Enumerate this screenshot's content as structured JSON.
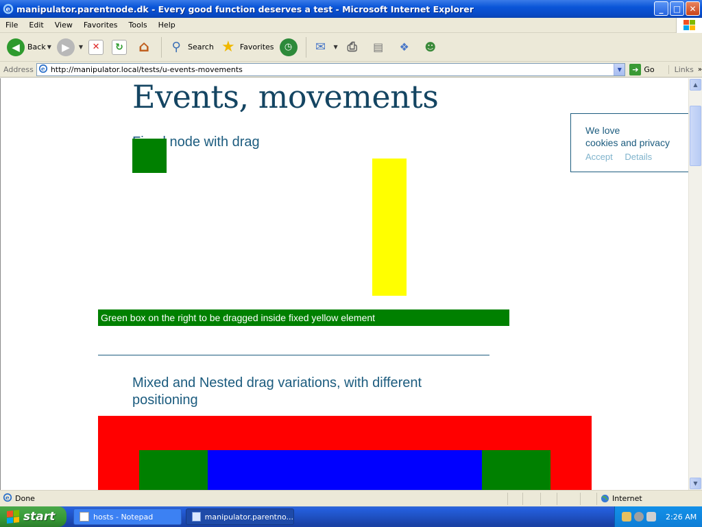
{
  "window": {
    "title": "manipulator.parentnode.dk - Every good function deserves a test - Microsoft Internet Explorer",
    "minimize": "_",
    "maximize": "□",
    "close": "✕"
  },
  "menu": [
    "File",
    "Edit",
    "View",
    "Favorites",
    "Tools",
    "Help"
  ],
  "toolbar": {
    "back": "Back",
    "search": "Search",
    "favorites": "Favorites"
  },
  "address": {
    "label": "Address",
    "url": "http://manipulator.local/tests/u-events-movements",
    "go": "Go",
    "links": "Links"
  },
  "page": {
    "title": "Events, movements",
    "section1_heading": "Fixed node with drag",
    "green_strip_text": "Green box on the right to be dragged inside fixed yellow element",
    "section2_heading_line1": "Mixed and Nested drag variations, with different",
    "section2_heading_line2": "positioning"
  },
  "cookie": {
    "line1": "We love",
    "line2": "cookies and privacy",
    "accept": "Accept",
    "details": "Details"
  },
  "status": {
    "text": "Done",
    "zone": "Internet"
  },
  "taskbar": {
    "start": "start",
    "task1": "hosts - Notepad",
    "task2": "manipulator.parentno...",
    "clock": "2:26 AM"
  },
  "colors": {
    "heading": "#144562",
    "green": "#008000",
    "yellow": "#ffff00",
    "red": "#ff0000",
    "blue": "#0000ff"
  }
}
